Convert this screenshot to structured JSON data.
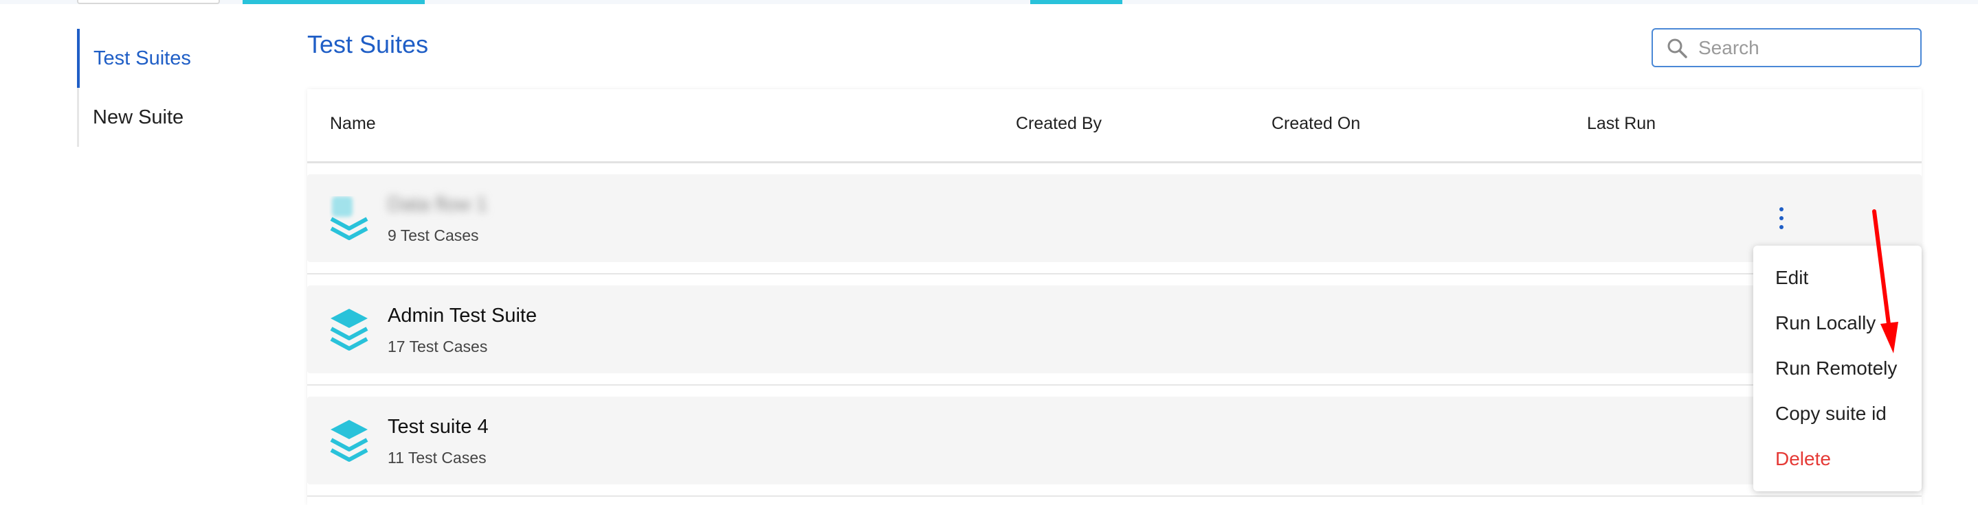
{
  "sidebar": {
    "items": [
      {
        "label": "Test Suites",
        "active": true
      },
      {
        "label": "New Suite",
        "active": false
      }
    ]
  },
  "header": {
    "title": "Test Suites"
  },
  "search": {
    "placeholder": "Search",
    "value": ""
  },
  "table": {
    "columns": [
      "Name",
      "Created By",
      "Created On",
      "Last Run"
    ],
    "rows": [
      {
        "name": "Data flow 1",
        "count": "9 Test Cases",
        "blurred": true
      },
      {
        "name": "Admin Test Suite",
        "count": "17 Test Cases",
        "blurred": false
      },
      {
        "name": "Test suite 4",
        "count": "11 Test Cases",
        "blurred": false
      }
    ]
  },
  "menu": {
    "items": [
      "Edit",
      "Run Locally",
      "Run Remotely",
      "Copy suite id",
      "Delete"
    ]
  },
  "colors": {
    "accent": "#1f5ec6",
    "icon": "#29c2da",
    "danger": "#e53935",
    "annotation": "#ff0000"
  }
}
